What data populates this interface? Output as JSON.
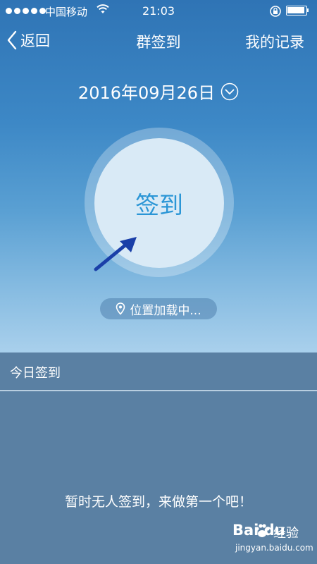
{
  "status_bar": {
    "carrier": "中国移动",
    "time": "21:03"
  },
  "nav": {
    "back_label": "返回",
    "title": "群签到",
    "records_label": "我的记录"
  },
  "date": {
    "value": "2016年09月26日"
  },
  "checkin": {
    "button_label": "签到"
  },
  "location": {
    "status": "位置加载中..."
  },
  "today": {
    "header": "今日签到",
    "empty_message": "暂时无人签到，来做第一个吧！"
  },
  "watermark": {
    "logo_text": "Bai du",
    "brand": "经验",
    "url": "jingyan.baidu.com"
  }
}
